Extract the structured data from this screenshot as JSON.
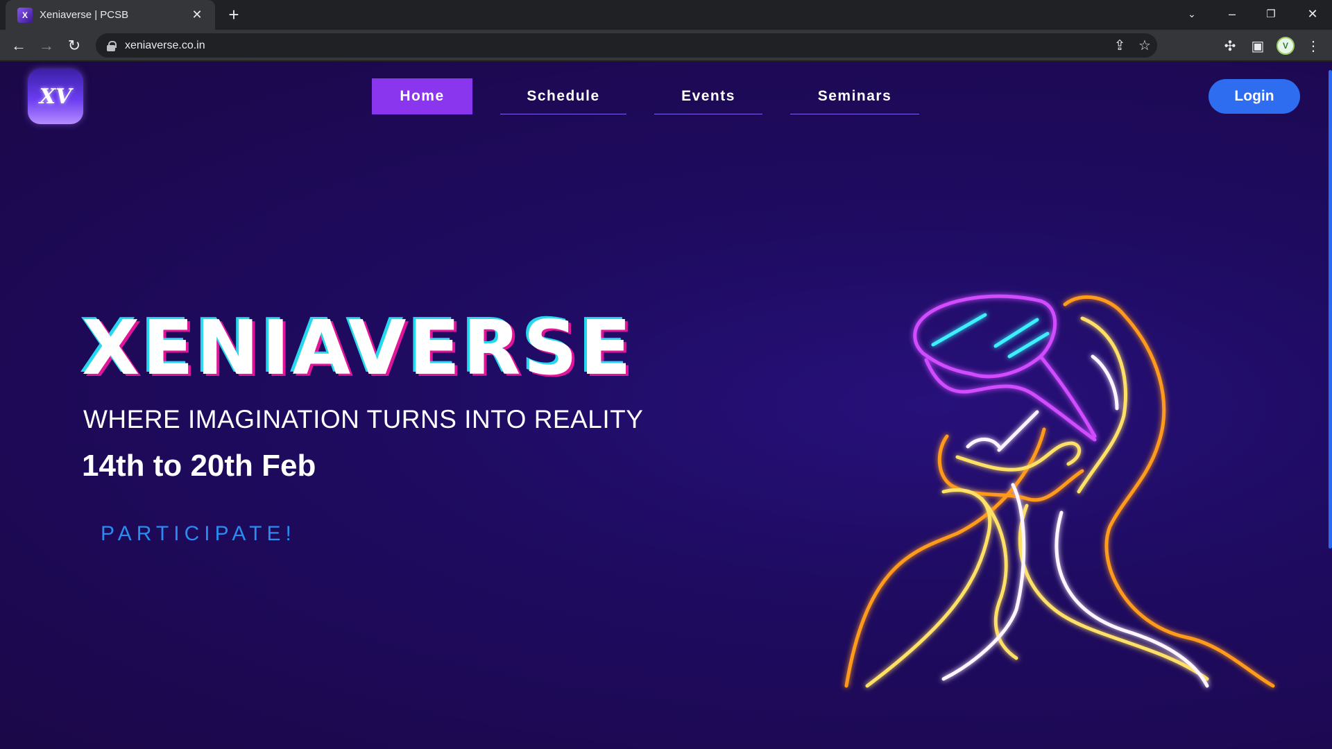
{
  "browser": {
    "tab_title": "Xeniaverse | PCSB",
    "tab_favicon_text": "X",
    "url": "xeniaverse.co.in",
    "profile_initial": "V"
  },
  "site": {
    "logo_text": "XV",
    "nav": [
      {
        "label": "Home",
        "active": true
      },
      {
        "label": "Schedule",
        "active": false
      },
      {
        "label": "Events",
        "active": false
      },
      {
        "label": "Seminars",
        "active": false
      }
    ],
    "login_label": "Login"
  },
  "hero": {
    "title": "XENIAVERSE",
    "subtitle": "WHERE IMAGINATION TURNS INTO REALITY",
    "date": "14th to 20th Feb",
    "cta": "PARTICIPATE!"
  },
  "colors": {
    "background": "#1f0c63",
    "active_nav": "#8a35ee",
    "login_button": "#2e6cf0",
    "cta_text": "#2a8cf2",
    "title_shadow_cyan": "#27d7ee",
    "title_shadow_magenta": "#e0159a"
  },
  "icons": {
    "back": "back-arrow-icon",
    "forward": "forward-arrow-icon",
    "reload": "reload-icon",
    "share": "share-icon",
    "bookmark": "star-icon",
    "extensions": "puzzle-icon",
    "side_panel": "side-panel-icon",
    "menu": "kebab-menu-icon"
  }
}
